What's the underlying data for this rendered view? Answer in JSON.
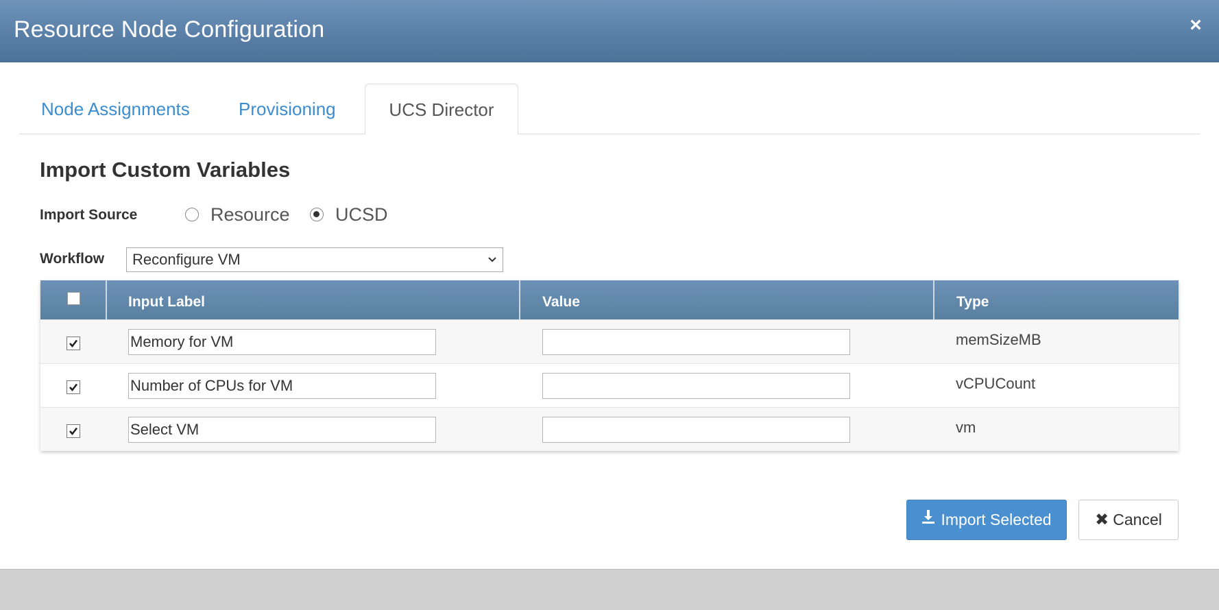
{
  "window": {
    "title": "Resource Node Configuration",
    "close_label": "×"
  },
  "tabs": [
    {
      "label": "Node Assignments",
      "active": false
    },
    {
      "label": "Provisioning",
      "active": false
    },
    {
      "label": "UCS Director",
      "active": true
    }
  ],
  "section": {
    "title": "Import Custom Variables"
  },
  "import_source": {
    "label": "Import Source",
    "options": [
      {
        "label": "Resource",
        "selected": false
      },
      {
        "label": "UCSD",
        "selected": true
      }
    ]
  },
  "workflow": {
    "label": "Workflow",
    "selected": "Reconfigure VM"
  },
  "table": {
    "columns": [
      "Input Label",
      "Value",
      "Type"
    ],
    "select_all_checked": false,
    "rows": [
      {
        "checked": true,
        "input_label": "Memory for VM",
        "value": "",
        "type": "memSizeMB"
      },
      {
        "checked": true,
        "input_label": "Number of CPUs for VM",
        "value": "",
        "type": "vCPUCount"
      },
      {
        "checked": true,
        "input_label": "Select VM",
        "value": "",
        "type": "vm"
      }
    ]
  },
  "buttons": {
    "import_label": "Import Selected",
    "cancel_label": "Cancel",
    "cancel_icon": "✖"
  },
  "colors": {
    "header": "#5a80a8",
    "accent": "#4a90d0",
    "tab_link": "#3c8dd0"
  }
}
